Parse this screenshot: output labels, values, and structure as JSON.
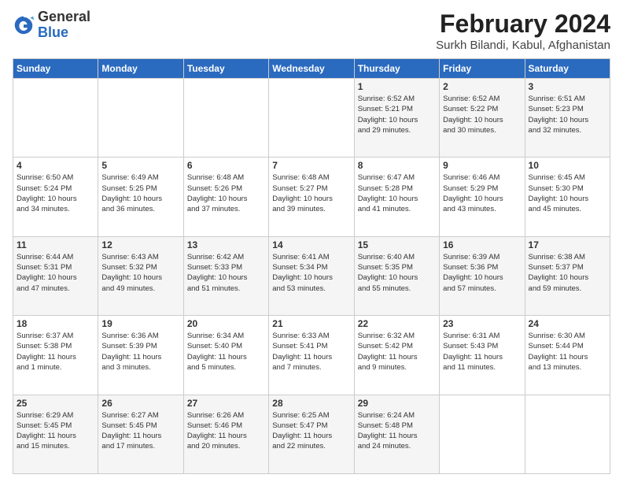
{
  "logo": {
    "general": "General",
    "blue": "Blue"
  },
  "header": {
    "title": "February 2024",
    "subtitle": "Surkh Bilandi, Kabul, Afghanistan"
  },
  "weekdays": [
    "Sunday",
    "Monday",
    "Tuesday",
    "Wednesday",
    "Thursday",
    "Friday",
    "Saturday"
  ],
  "weeks": [
    [
      {
        "day": "",
        "info": ""
      },
      {
        "day": "",
        "info": ""
      },
      {
        "day": "",
        "info": ""
      },
      {
        "day": "",
        "info": ""
      },
      {
        "day": "1",
        "info": "Sunrise: 6:52 AM\nSunset: 5:21 PM\nDaylight: 10 hours\nand 29 minutes."
      },
      {
        "day": "2",
        "info": "Sunrise: 6:52 AM\nSunset: 5:22 PM\nDaylight: 10 hours\nand 30 minutes."
      },
      {
        "day": "3",
        "info": "Sunrise: 6:51 AM\nSunset: 5:23 PM\nDaylight: 10 hours\nand 32 minutes."
      }
    ],
    [
      {
        "day": "4",
        "info": "Sunrise: 6:50 AM\nSunset: 5:24 PM\nDaylight: 10 hours\nand 34 minutes."
      },
      {
        "day": "5",
        "info": "Sunrise: 6:49 AM\nSunset: 5:25 PM\nDaylight: 10 hours\nand 36 minutes."
      },
      {
        "day": "6",
        "info": "Sunrise: 6:48 AM\nSunset: 5:26 PM\nDaylight: 10 hours\nand 37 minutes."
      },
      {
        "day": "7",
        "info": "Sunrise: 6:48 AM\nSunset: 5:27 PM\nDaylight: 10 hours\nand 39 minutes."
      },
      {
        "day": "8",
        "info": "Sunrise: 6:47 AM\nSunset: 5:28 PM\nDaylight: 10 hours\nand 41 minutes."
      },
      {
        "day": "9",
        "info": "Sunrise: 6:46 AM\nSunset: 5:29 PM\nDaylight: 10 hours\nand 43 minutes."
      },
      {
        "day": "10",
        "info": "Sunrise: 6:45 AM\nSunset: 5:30 PM\nDaylight: 10 hours\nand 45 minutes."
      }
    ],
    [
      {
        "day": "11",
        "info": "Sunrise: 6:44 AM\nSunset: 5:31 PM\nDaylight: 10 hours\nand 47 minutes."
      },
      {
        "day": "12",
        "info": "Sunrise: 6:43 AM\nSunset: 5:32 PM\nDaylight: 10 hours\nand 49 minutes."
      },
      {
        "day": "13",
        "info": "Sunrise: 6:42 AM\nSunset: 5:33 PM\nDaylight: 10 hours\nand 51 minutes."
      },
      {
        "day": "14",
        "info": "Sunrise: 6:41 AM\nSunset: 5:34 PM\nDaylight: 10 hours\nand 53 minutes."
      },
      {
        "day": "15",
        "info": "Sunrise: 6:40 AM\nSunset: 5:35 PM\nDaylight: 10 hours\nand 55 minutes."
      },
      {
        "day": "16",
        "info": "Sunrise: 6:39 AM\nSunset: 5:36 PM\nDaylight: 10 hours\nand 57 minutes."
      },
      {
        "day": "17",
        "info": "Sunrise: 6:38 AM\nSunset: 5:37 PM\nDaylight: 10 hours\nand 59 minutes."
      }
    ],
    [
      {
        "day": "18",
        "info": "Sunrise: 6:37 AM\nSunset: 5:38 PM\nDaylight: 11 hours\nand 1 minute."
      },
      {
        "day": "19",
        "info": "Sunrise: 6:36 AM\nSunset: 5:39 PM\nDaylight: 11 hours\nand 3 minutes."
      },
      {
        "day": "20",
        "info": "Sunrise: 6:34 AM\nSunset: 5:40 PM\nDaylight: 11 hours\nand 5 minutes."
      },
      {
        "day": "21",
        "info": "Sunrise: 6:33 AM\nSunset: 5:41 PM\nDaylight: 11 hours\nand 7 minutes."
      },
      {
        "day": "22",
        "info": "Sunrise: 6:32 AM\nSunset: 5:42 PM\nDaylight: 11 hours\nand 9 minutes."
      },
      {
        "day": "23",
        "info": "Sunrise: 6:31 AM\nSunset: 5:43 PM\nDaylight: 11 hours\nand 11 minutes."
      },
      {
        "day": "24",
        "info": "Sunrise: 6:30 AM\nSunset: 5:44 PM\nDaylight: 11 hours\nand 13 minutes."
      }
    ],
    [
      {
        "day": "25",
        "info": "Sunrise: 6:29 AM\nSunset: 5:45 PM\nDaylight: 11 hours\nand 15 minutes."
      },
      {
        "day": "26",
        "info": "Sunrise: 6:27 AM\nSunset: 5:45 PM\nDaylight: 11 hours\nand 17 minutes."
      },
      {
        "day": "27",
        "info": "Sunrise: 6:26 AM\nSunset: 5:46 PM\nDaylight: 11 hours\nand 20 minutes."
      },
      {
        "day": "28",
        "info": "Sunrise: 6:25 AM\nSunset: 5:47 PM\nDaylight: 11 hours\nand 22 minutes."
      },
      {
        "day": "29",
        "info": "Sunrise: 6:24 AM\nSunset: 5:48 PM\nDaylight: 11 hours\nand 24 minutes."
      },
      {
        "day": "",
        "info": ""
      },
      {
        "day": "",
        "info": ""
      }
    ]
  ]
}
